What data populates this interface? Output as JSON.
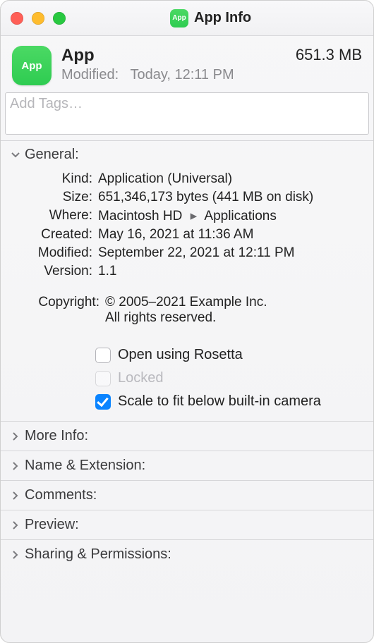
{
  "titlebar": {
    "title": "App Info",
    "icon_label": "App"
  },
  "header": {
    "icon_label": "App",
    "name": "App",
    "size": "651.3 MB",
    "modified_prefix": "Modified:",
    "modified_value": "Today, 12:11 PM"
  },
  "tags": {
    "placeholder": "Add Tags…"
  },
  "general": {
    "title": "General:",
    "rows": {
      "kind": {
        "key": "Kind:",
        "val": "Application (Universal)"
      },
      "size": {
        "key": "Size:",
        "val": "651,346,173 bytes (441 MB on disk)"
      },
      "where": {
        "key": "Where:",
        "loc1": "Macintosh HD",
        "loc2": "Applications"
      },
      "created": {
        "key": "Created:",
        "val": "May 16, 2021 at 11:36 AM"
      },
      "modified": {
        "key": "Modified:",
        "val": "September 22, 2021 at 12:11 PM"
      },
      "version": {
        "key": "Version:",
        "val": "1.1"
      },
      "copyright": {
        "key": "Copyright:",
        "line1": "© 2005–2021 Example Inc.",
        "line2": "All rights reserved."
      }
    },
    "checks": {
      "rosetta": {
        "label": "Open using Rosetta"
      },
      "locked": {
        "label": "Locked"
      },
      "scalefit": {
        "label": "Scale to fit below built-in camera"
      }
    }
  },
  "sections": {
    "moreinfo": "More Info:",
    "namext": "Name & Extension:",
    "comments": "Comments:",
    "preview": "Preview:",
    "sharing": "Sharing & Permissions:"
  }
}
